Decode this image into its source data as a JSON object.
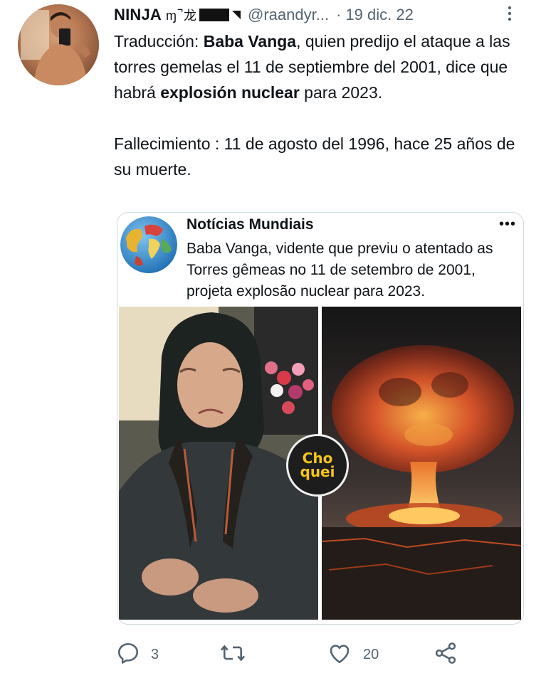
{
  "author": {
    "name": "NINJA",
    "name_glyphs": "ɱ ̚ 龙",
    "handle": "@raandyr...",
    "separator": "·",
    "date": "19 dic. 22"
  },
  "tweet": {
    "line1_prefix": "Traducción: ",
    "line1_bold": "Baba Vanga",
    "line1_rest": ",  quien predijo el ataque a las torres gemelas el 11 de septiembre del 2001, dice que habrá ",
    "line1_bold2": "explosión nuclear",
    "line1_end": " para 2023.",
    "paragraph2": "Fallecimiento : 11 de agosto del 1996, hace 25 años de su muerte."
  },
  "quote": {
    "account": "Notícias Mundiais",
    "more": "•••",
    "text": "Baba Vanga, vidente que previu o atentado as Torres gêmeas no 11 de setembro de 2001, projeta explosão nuclear para 2023.",
    "badge_line1": "Cho",
    "badge_line2": "quei"
  },
  "actions": {
    "replies": "3",
    "likes": "20"
  },
  "colors": {
    "text": "#0f1419",
    "secondary": "#536471",
    "border": "#cfd9de",
    "badge_yellow": "#f5c518"
  },
  "icons": [
    "reply-icon",
    "retweet-icon",
    "like-icon",
    "share-icon",
    "more-vertical-icon",
    "more-horizontal-icon"
  ]
}
